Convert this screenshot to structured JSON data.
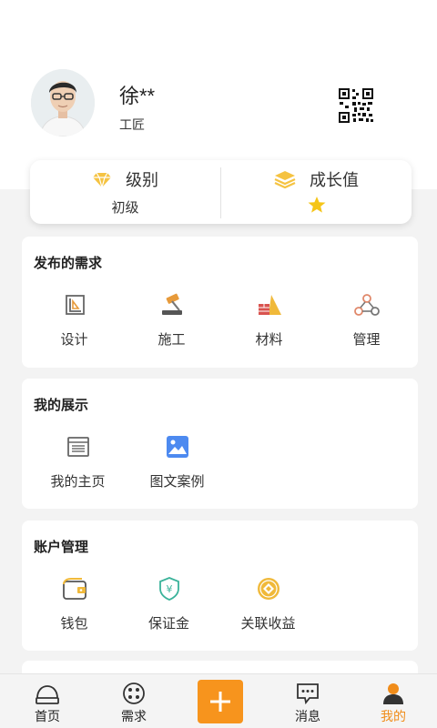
{
  "profile": {
    "name": "徐**",
    "role": "工匠",
    "avatar_icon": "user-avatar-photo",
    "qr_icon": "qr-code-icon"
  },
  "stats": {
    "level_label": "级别",
    "level_value": "初级",
    "growth_label": "成长值",
    "growth_stars": 1
  },
  "sections": [
    {
      "title": "发布的需求",
      "items": [
        {
          "label": "设计",
          "icon": "design-icon"
        },
        {
          "label": "施工",
          "icon": "construction-hammer-icon"
        },
        {
          "label": "材料",
          "icon": "materials-icon"
        },
        {
          "label": "管理",
          "icon": "management-icon"
        }
      ]
    },
    {
      "title": "我的展示",
      "items": [
        {
          "label": "我的主页",
          "icon": "homepage-list-icon"
        },
        {
          "label": "图文案例",
          "icon": "image-case-icon"
        }
      ]
    },
    {
      "title": "账户管理",
      "items": [
        {
          "label": "钱包",
          "icon": "wallet-icon"
        },
        {
          "label": "保证金",
          "icon": "deposit-shield-icon"
        },
        {
          "label": "关联收益",
          "icon": "earnings-coin-icon"
        }
      ]
    }
  ],
  "tabbar": {
    "tabs": [
      {
        "label": "首页",
        "icon": "home-icon"
      },
      {
        "label": "需求",
        "icon": "demand-icon"
      },
      {
        "label": "消息",
        "icon": "message-icon"
      },
      {
        "label": "我的",
        "icon": "profile-icon"
      }
    ],
    "active_index": 3
  },
  "colors": {
    "accent": "#f7941d",
    "star": "#f5c518",
    "level_icon": "#f5c342",
    "blue_icon": "#4d8af0",
    "green_icon": "#3ab39a"
  }
}
